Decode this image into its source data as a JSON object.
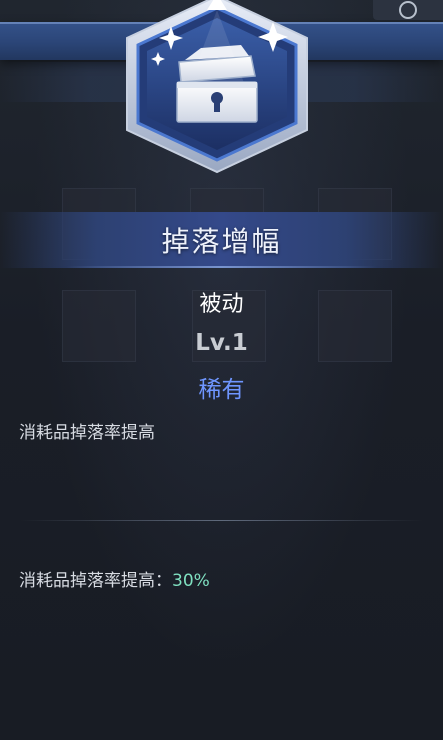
{
  "skill": {
    "name": "掉落增幅",
    "type": "被动",
    "level": "Lv.1",
    "rarity": "稀有",
    "description": "消耗品掉落率提高",
    "stat_label": "消耗品掉落率提高：",
    "stat_value": "30%"
  },
  "icon": {
    "name": "treasure-chest-icon"
  },
  "colors": {
    "rarity": "#6f96ff",
    "stat_value": "#7fe0c0",
    "banner": "#2b4577"
  }
}
